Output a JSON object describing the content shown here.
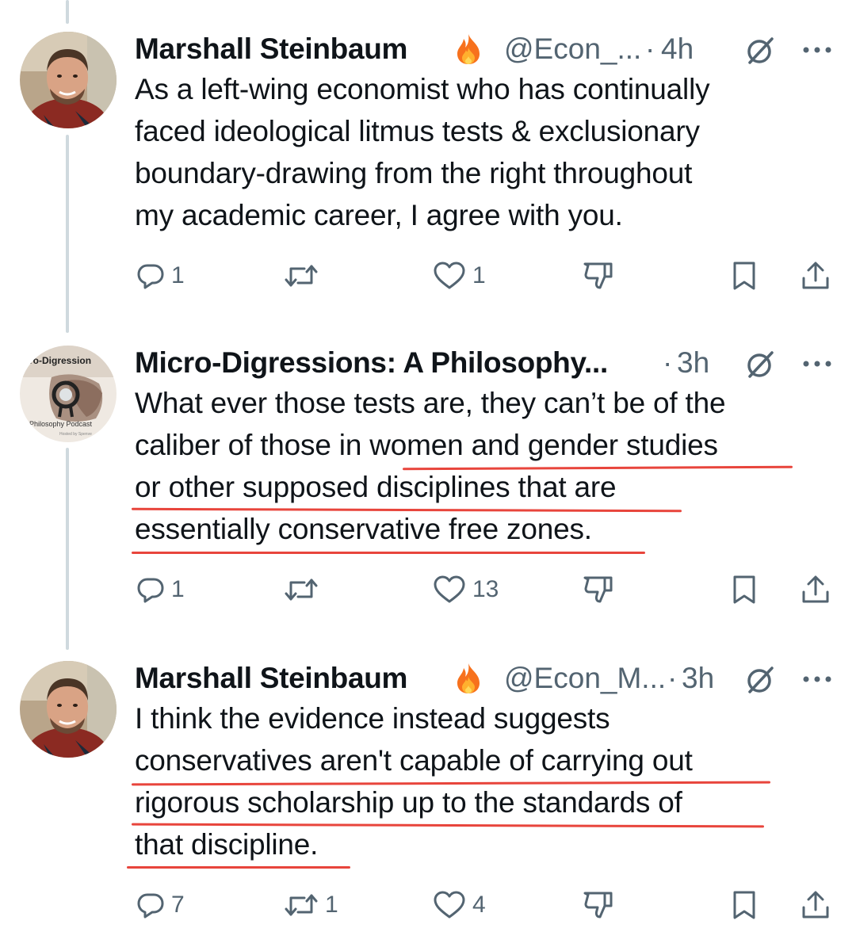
{
  "tweets": [
    {
      "display_name": "Marshall Steinbaum",
      "emoji_icon": "fire-emoji",
      "handle": "@Econ_...",
      "time": "4h",
      "avatar": "profile-photo-man",
      "body_lines": [
        "As a left-wing economist who has continually",
        "faced ideological litmus tests & exclusionary",
        "boundary-drawing from the right throughout",
        "my academic career, I agree with you."
      ],
      "underlined_lines": [],
      "actions": {
        "replies": "1",
        "reposts": "",
        "likes": "1"
      }
    },
    {
      "display_name": "Micro-Digressions: A Philosophy...",
      "emoji_icon": "",
      "handle": "",
      "time": "3h",
      "avatar": "podcast-logo",
      "avatar_text": {
        "title": "icro-Digression",
        "subtitle": "A Philosophy Podcast",
        "footnote": "Hosted by Spenve"
      },
      "body_lines": [
        "What ever those tests are, they can’t be of the",
        "caliber of those in women and gender studies",
        "or other supposed disciplines that are",
        "essentially conservative free zones."
      ],
      "actions": {
        "replies": "1",
        "reposts": "",
        "likes": "13"
      }
    },
    {
      "display_name": "Marshall Steinbaum",
      "emoji_icon": "fire-emoji",
      "handle": "@Econ_M...",
      "time": "3h",
      "avatar": "profile-photo-man",
      "body_lines": [
        "I think the evidence instead suggests",
        "conservatives aren't capable of carrying out",
        "rigorous scholarship up to the standards of",
        "that discipline."
      ],
      "actions": {
        "replies": "7",
        "reposts": "1",
        "likes": "4"
      }
    }
  ],
  "colors": {
    "text": "#0f1419",
    "secondary": "#536471",
    "thread_line": "#cfd9de",
    "annotation_underline": "#e8453c"
  },
  "icons": [
    "reply-icon",
    "repost-icon",
    "like-icon",
    "downvote-icon",
    "bookmark-icon",
    "share-icon",
    "grok-icon",
    "more-icon",
    "fire-emoji"
  ]
}
